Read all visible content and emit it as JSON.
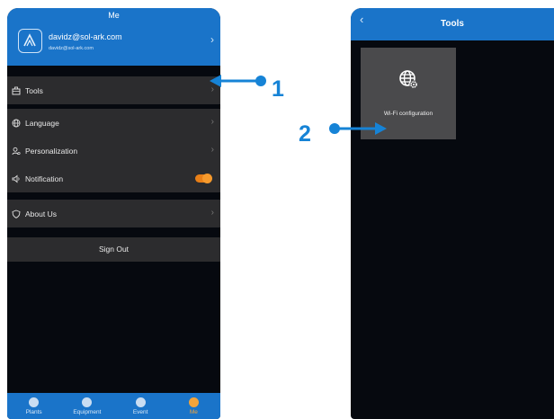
{
  "left_screen": {
    "title": "Me",
    "user": {
      "email": "davidz@sol-ark.com",
      "username": "davidz@sol-ark.com"
    },
    "menu": {
      "tools": "Tools",
      "language": "Language",
      "personalization": "Personalization",
      "notification": "Notification",
      "notification_on": true,
      "about": "About Us"
    },
    "sign_out": "Sign Out",
    "nav": {
      "plants": "Plants",
      "equipment": "Equipment",
      "event": "Event",
      "me": "Me",
      "active": "Me"
    }
  },
  "right_screen": {
    "title": "Tools",
    "tile_label": "Wi-Fi configuration"
  },
  "annotations": {
    "one": "1",
    "two": "2"
  },
  "colors": {
    "header_blue": "#1a74c9",
    "annotation_blue": "#1683d6",
    "toggle_orange": "#e87f17",
    "active_tab": "#f3a43b"
  }
}
